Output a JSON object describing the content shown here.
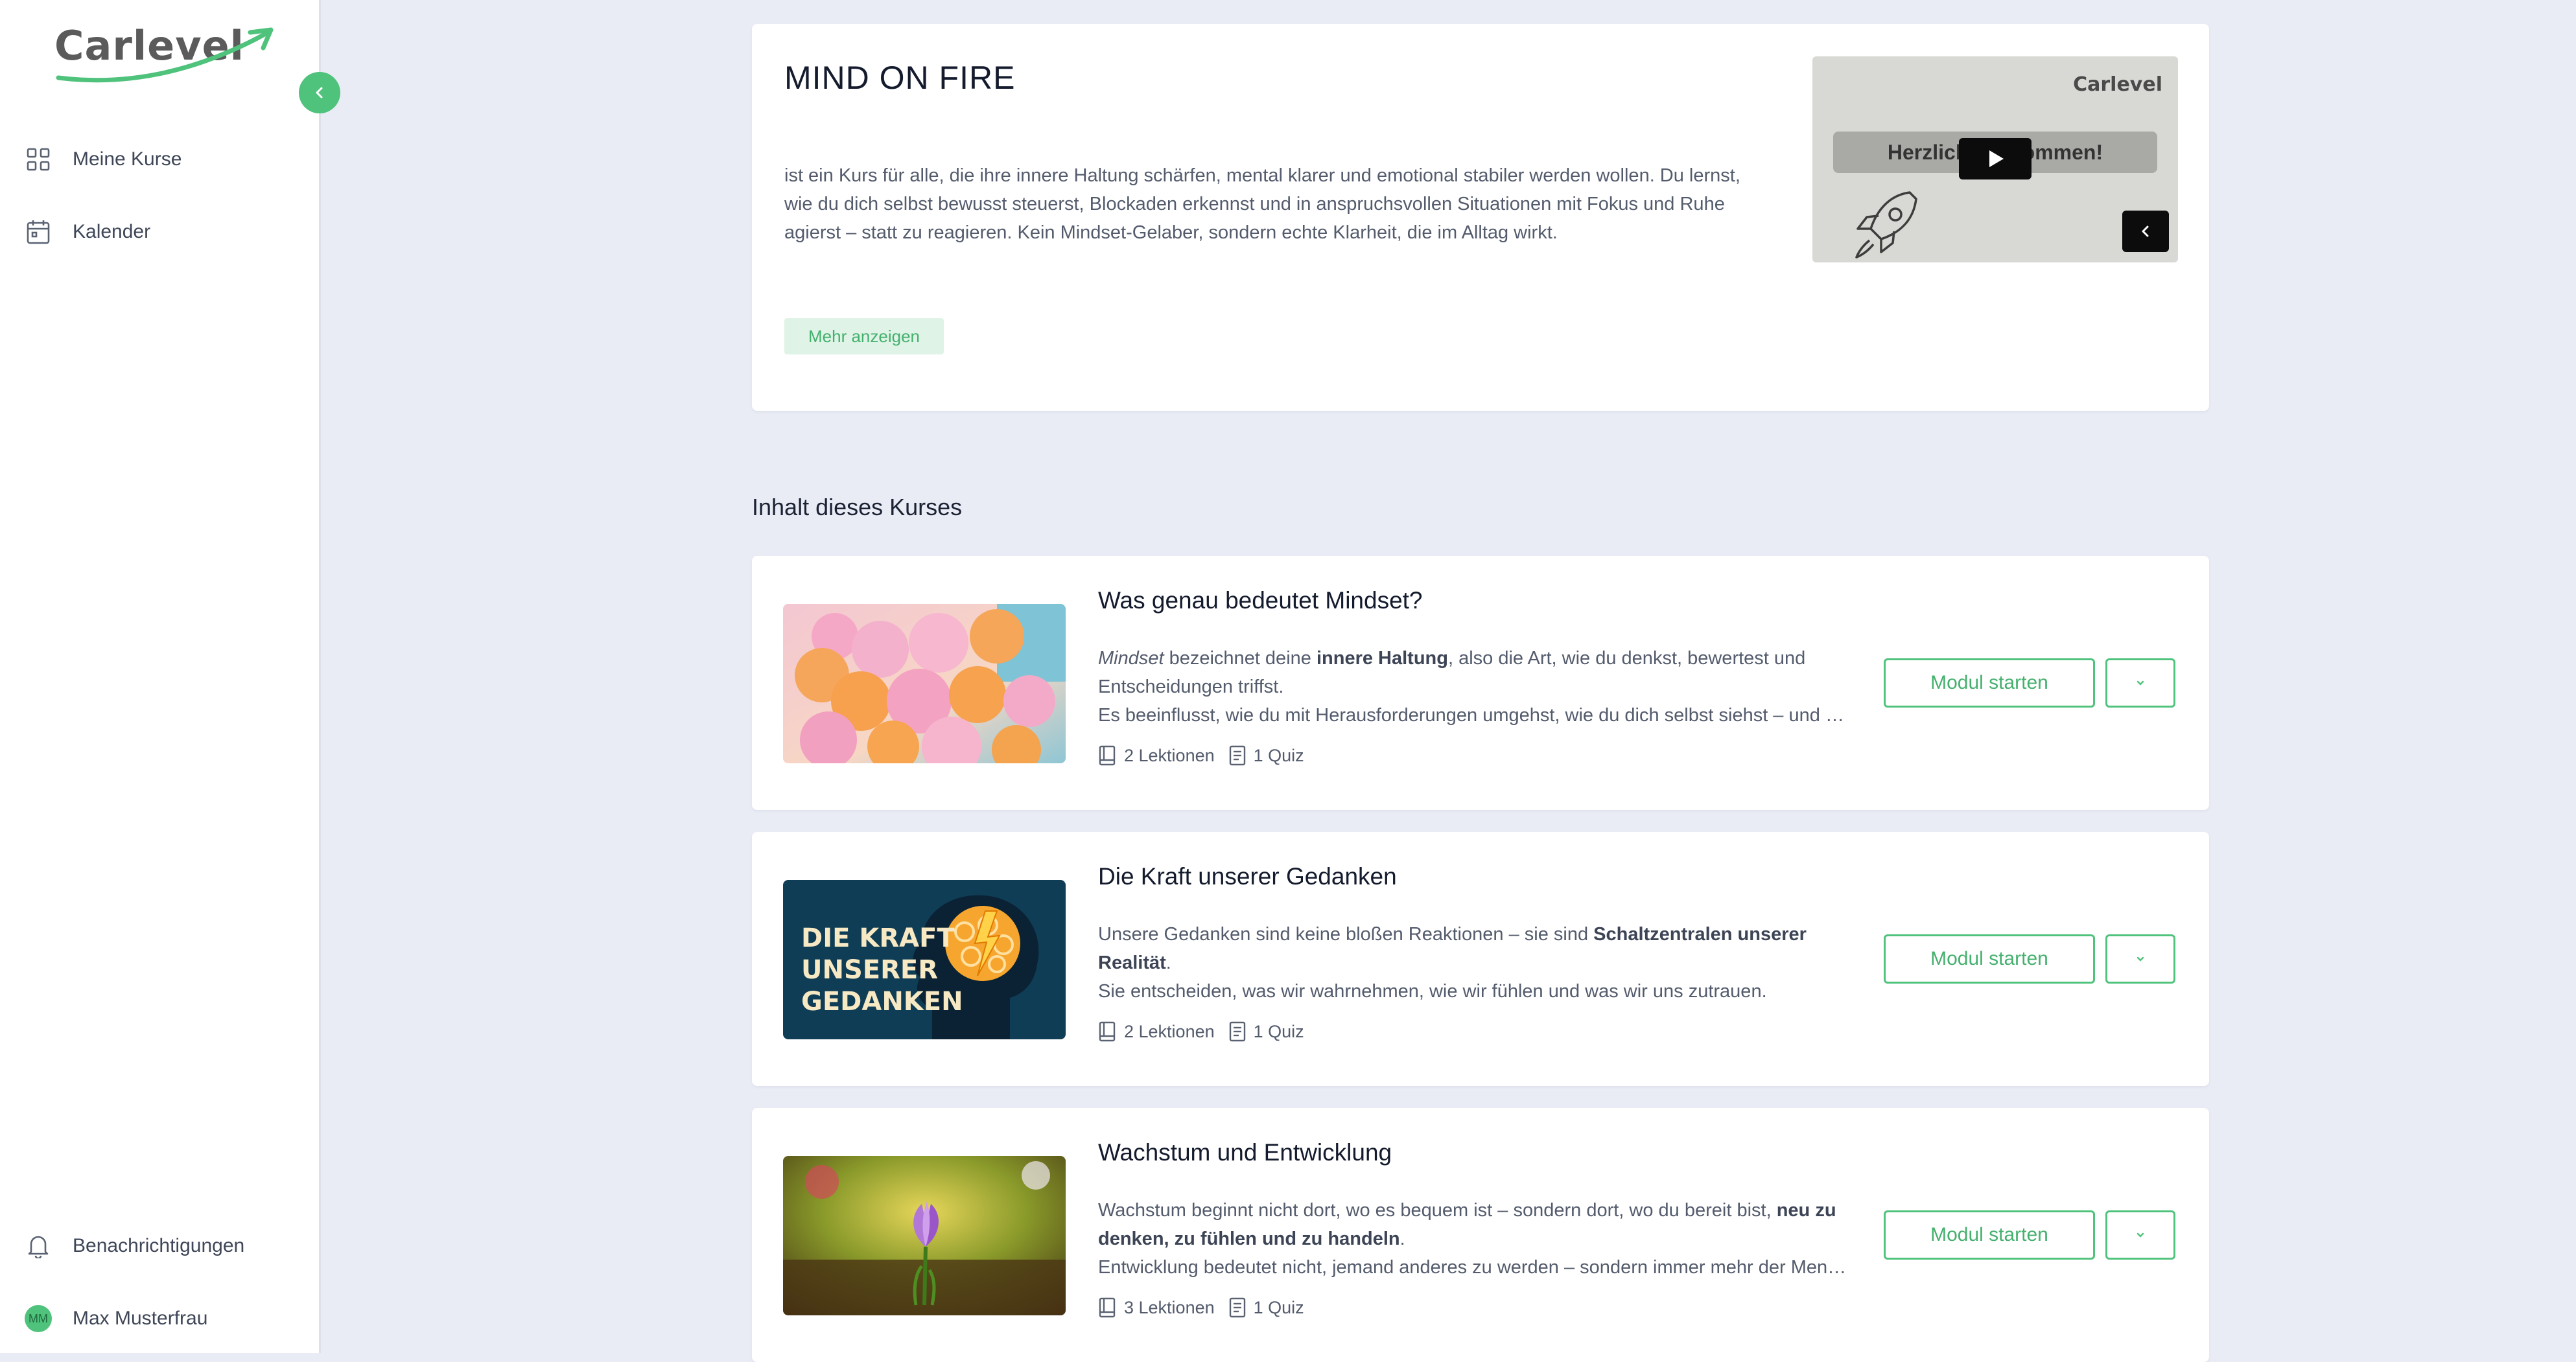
{
  "brand": {
    "logo_text": "Carlevel",
    "accent": "#4fc27c"
  },
  "sidebar": {
    "items": [
      {
        "label": "Meine Kurse",
        "icon": "grid-icon"
      },
      {
        "label": "Kalender",
        "icon": "calendar-icon"
      }
    ],
    "bottom": {
      "notifications_label": "Benachrichtigungen",
      "user_initials": "MM",
      "user_name": "Max Musterfrau"
    }
  },
  "course": {
    "title": "MIND ON FIRE",
    "description": "ist ein Kurs für alle, die ihre innere Haltung schärfen, mental klarer und emotional stabiler werden wollen. Du lernst, wie du dich selbst bewusst steuerst, Blockaden erkennst und in anspruchsvollen Situationen mit Fokus und Ruhe agierst – statt zu reagieren. Kein Mindset-Gelaber, sondern echte Klarheit, die im Alltag wirkt.",
    "more_label": "Mehr anzeigen",
    "video": {
      "brand": "Carlevel",
      "banner": "Herzlich Willkommen!"
    }
  },
  "content_section_title": "Inhalt dieses Kurses",
  "modules": [
    {
      "title": "Was genau bedeutet Mindset?",
      "line1_em": "Mindset",
      "line1_a": " bezeichnet deine ",
      "line1_b": "innere Haltung",
      "line1_c": ", also die Art, wie du denkst, bewertest und Entscheidungen triffst.",
      "line3": "Es beeinflusst, wie du mit Herausforderungen umgehst, wie du dich selbst siehst – und wie du mit anderen in Beziehung trittst.",
      "lessons": "2 Lektionen",
      "quiz": "1 Quiz",
      "start_label": "Modul starten"
    },
    {
      "title": "Die Kraft unserer Gedanken",
      "thumb_text": [
        "DIE KRAFT",
        "UNSERER",
        "GEDANKEN"
      ],
      "line1_a": "Unsere Gedanken sind keine bloßen Reaktionen – sie sind ",
      "line1_b": "Schaltzentralen unserer Realität",
      "line1_c": ".",
      "line3": "Sie entscheiden, was wir wahrnehmen, wie wir fühlen und was wir uns zutrauen.",
      "lessons": "2 Lektionen",
      "quiz": "1 Quiz",
      "start_label": "Modul starten"
    },
    {
      "title": "Wachstum und Entwicklung",
      "line1_a": "Wachstum beginnt nicht dort, wo es bequem ist – sondern dort, wo du bereit bist, ",
      "line1_b": "neu zu denken, zu fühlen und zu handeln",
      "line1_c": ".",
      "line3": "Entwicklung bedeutet nicht, jemand anderes zu werden – sondern immer mehr der Mensch zu sein, der du wirklich bist.",
      "lessons": "3 Lektionen",
      "quiz": "1 Quiz",
      "start_label": "Modul starten"
    }
  ]
}
